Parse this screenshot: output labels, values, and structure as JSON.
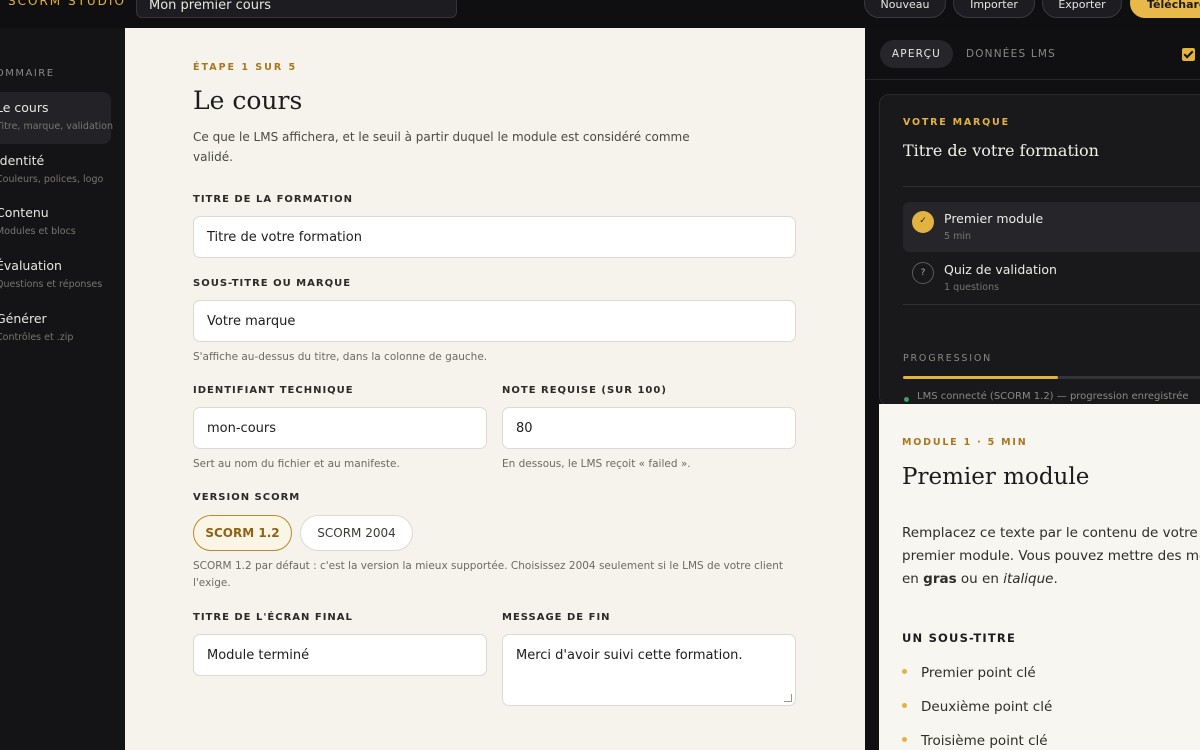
{
  "topbar": {
    "brand": "SCORM STUDIO",
    "course_name": "Mon premier cours",
    "buttons": {
      "new": "Nouveau",
      "import": "Importer",
      "export": "Exporter",
      "download": "Télécharger"
    }
  },
  "sidebar": {
    "heading": "SOMMAIRE",
    "items": [
      {
        "title": "Le cours",
        "subtitle": "Titre, marque, validation"
      },
      {
        "title": "Identité",
        "subtitle": "Couleurs, polices, logo"
      },
      {
        "title": "Contenu",
        "subtitle": "Modules et blocs"
      },
      {
        "title": "Évaluation",
        "subtitle": "Questions et réponses"
      },
      {
        "title": "Générer",
        "subtitle": "Contrôles et .zip"
      }
    ]
  },
  "form": {
    "step": "ÉTAPE 1 SUR 5",
    "title": "Le cours",
    "lead": "Ce que le LMS affichera, et le seuil à partir duquel le module est considéré comme validé.",
    "course_title": {
      "label": "TITRE DE LA FORMATION",
      "value": "Titre de votre formation"
    },
    "subtitle": {
      "label": "SOUS-TITRE OU MARQUE",
      "value": "Votre marque",
      "help": "S'affiche au-dessus du titre, dans la colonne de gauche."
    },
    "identifier": {
      "label": "IDENTIFIANT TECHNIQUE",
      "value": "mon-cours",
      "help": "Sert au nom du fichier et au manifeste."
    },
    "score": {
      "label": "NOTE REQUISE (SUR 100)",
      "value": "80",
      "help": "En dessous, le LMS reçoit « failed »."
    },
    "version": {
      "label": "VERSION SCORM",
      "options": [
        "SCORM 1.2",
        "SCORM 2004"
      ],
      "selected": "SCORM 1.2",
      "help": "SCORM 1.2 par défaut : c'est la version la mieux supportée. Choisissez 2004 seulement si le LMS de votre client l'exige."
    },
    "final_title": {
      "label": "TITRE DE L'ÉCRAN FINAL",
      "value": "Module terminé"
    },
    "end_message": {
      "label": "MESSAGE DE FIN",
      "value": "Merci d'avoir suivi cette formation."
    }
  },
  "preview": {
    "tabs": [
      "APERÇU",
      "DONNÉES LMS"
    ],
    "active_tab": "APERÇU",
    "card": {
      "eyebrow": "VOTRE MARQUE",
      "title": "Titre de votre formation",
      "modules": [
        {
          "title": "Premier module",
          "meta": "5 min",
          "status": "done"
        },
        {
          "title": "Quiz de validation",
          "meta": "1 questions",
          "status": "pending",
          "icon_glyph": "?"
        }
      ],
      "progress_label": "PROGRESSION",
      "progress": 0.5,
      "status": "LMS connecté (SCORM 1.2) — progression enregistrée"
    },
    "content": {
      "eyebrow": "MODULE 1 · 5 MIN",
      "title": "Premier module",
      "body_1": "Remplacez ce texte par le contenu de votre",
      "body_2": "premier module. Vous pouvez mettre des mots",
      "body_3a": "en ",
      "body_bold": "gras",
      "body_3b": " ou en ",
      "body_italic": "italique",
      "body_3c": ".",
      "subheading": "UN SOUS-TITRE",
      "bullets": [
        "Premier point clé",
        "Deuxième point clé",
        "Troisième point clé"
      ]
    },
    "accent": "#e3b341"
  }
}
